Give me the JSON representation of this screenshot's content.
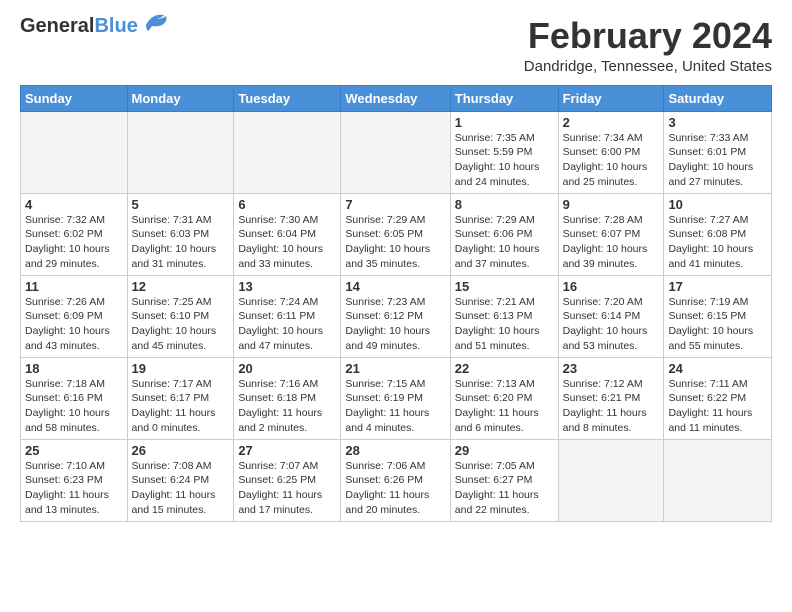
{
  "header": {
    "logo_general": "General",
    "logo_blue": "Blue",
    "title": "February 2024",
    "location": "Dandridge, Tennessee, United States"
  },
  "weekdays": [
    "Sunday",
    "Monday",
    "Tuesday",
    "Wednesday",
    "Thursday",
    "Friday",
    "Saturday"
  ],
  "weeks": [
    [
      {
        "day": "",
        "info": ""
      },
      {
        "day": "",
        "info": ""
      },
      {
        "day": "",
        "info": ""
      },
      {
        "day": "",
        "info": ""
      },
      {
        "day": "1",
        "info": "Sunrise: 7:35 AM\nSunset: 5:59 PM\nDaylight: 10 hours\nand 24 minutes."
      },
      {
        "day": "2",
        "info": "Sunrise: 7:34 AM\nSunset: 6:00 PM\nDaylight: 10 hours\nand 25 minutes."
      },
      {
        "day": "3",
        "info": "Sunrise: 7:33 AM\nSunset: 6:01 PM\nDaylight: 10 hours\nand 27 minutes."
      }
    ],
    [
      {
        "day": "4",
        "info": "Sunrise: 7:32 AM\nSunset: 6:02 PM\nDaylight: 10 hours\nand 29 minutes."
      },
      {
        "day": "5",
        "info": "Sunrise: 7:31 AM\nSunset: 6:03 PM\nDaylight: 10 hours\nand 31 minutes."
      },
      {
        "day": "6",
        "info": "Sunrise: 7:30 AM\nSunset: 6:04 PM\nDaylight: 10 hours\nand 33 minutes."
      },
      {
        "day": "7",
        "info": "Sunrise: 7:29 AM\nSunset: 6:05 PM\nDaylight: 10 hours\nand 35 minutes."
      },
      {
        "day": "8",
        "info": "Sunrise: 7:29 AM\nSunset: 6:06 PM\nDaylight: 10 hours\nand 37 minutes."
      },
      {
        "day": "9",
        "info": "Sunrise: 7:28 AM\nSunset: 6:07 PM\nDaylight: 10 hours\nand 39 minutes."
      },
      {
        "day": "10",
        "info": "Sunrise: 7:27 AM\nSunset: 6:08 PM\nDaylight: 10 hours\nand 41 minutes."
      }
    ],
    [
      {
        "day": "11",
        "info": "Sunrise: 7:26 AM\nSunset: 6:09 PM\nDaylight: 10 hours\nand 43 minutes."
      },
      {
        "day": "12",
        "info": "Sunrise: 7:25 AM\nSunset: 6:10 PM\nDaylight: 10 hours\nand 45 minutes."
      },
      {
        "day": "13",
        "info": "Sunrise: 7:24 AM\nSunset: 6:11 PM\nDaylight: 10 hours\nand 47 minutes."
      },
      {
        "day": "14",
        "info": "Sunrise: 7:23 AM\nSunset: 6:12 PM\nDaylight: 10 hours\nand 49 minutes."
      },
      {
        "day": "15",
        "info": "Sunrise: 7:21 AM\nSunset: 6:13 PM\nDaylight: 10 hours\nand 51 minutes."
      },
      {
        "day": "16",
        "info": "Sunrise: 7:20 AM\nSunset: 6:14 PM\nDaylight: 10 hours\nand 53 minutes."
      },
      {
        "day": "17",
        "info": "Sunrise: 7:19 AM\nSunset: 6:15 PM\nDaylight: 10 hours\nand 55 minutes."
      }
    ],
    [
      {
        "day": "18",
        "info": "Sunrise: 7:18 AM\nSunset: 6:16 PM\nDaylight: 10 hours\nand 58 minutes."
      },
      {
        "day": "19",
        "info": "Sunrise: 7:17 AM\nSunset: 6:17 PM\nDaylight: 11 hours\nand 0 minutes."
      },
      {
        "day": "20",
        "info": "Sunrise: 7:16 AM\nSunset: 6:18 PM\nDaylight: 11 hours\nand 2 minutes."
      },
      {
        "day": "21",
        "info": "Sunrise: 7:15 AM\nSunset: 6:19 PM\nDaylight: 11 hours\nand 4 minutes."
      },
      {
        "day": "22",
        "info": "Sunrise: 7:13 AM\nSunset: 6:20 PM\nDaylight: 11 hours\nand 6 minutes."
      },
      {
        "day": "23",
        "info": "Sunrise: 7:12 AM\nSunset: 6:21 PM\nDaylight: 11 hours\nand 8 minutes."
      },
      {
        "day": "24",
        "info": "Sunrise: 7:11 AM\nSunset: 6:22 PM\nDaylight: 11 hours\nand 11 minutes."
      }
    ],
    [
      {
        "day": "25",
        "info": "Sunrise: 7:10 AM\nSunset: 6:23 PM\nDaylight: 11 hours\nand 13 minutes."
      },
      {
        "day": "26",
        "info": "Sunrise: 7:08 AM\nSunset: 6:24 PM\nDaylight: 11 hours\nand 15 minutes."
      },
      {
        "day": "27",
        "info": "Sunrise: 7:07 AM\nSunset: 6:25 PM\nDaylight: 11 hours\nand 17 minutes."
      },
      {
        "day": "28",
        "info": "Sunrise: 7:06 AM\nSunset: 6:26 PM\nDaylight: 11 hours\nand 20 minutes."
      },
      {
        "day": "29",
        "info": "Sunrise: 7:05 AM\nSunset: 6:27 PM\nDaylight: 11 hours\nand 22 minutes."
      },
      {
        "day": "",
        "info": ""
      },
      {
        "day": "",
        "info": ""
      }
    ]
  ]
}
